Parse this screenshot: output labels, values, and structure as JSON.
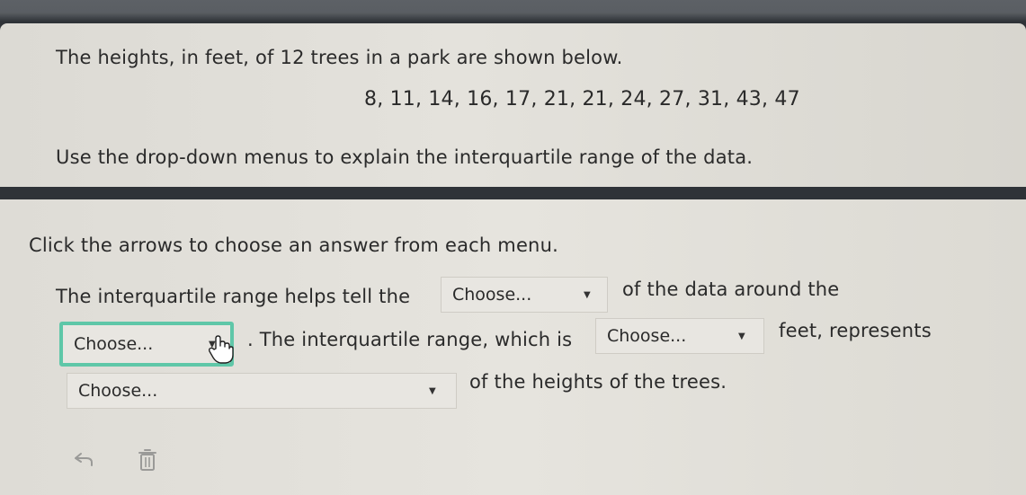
{
  "question": {
    "prompt": "The heights, in feet, of 12 trees in a park are shown below.",
    "data_values": "8, 11, 14, 16, 17, 21, 21, 24, 27, 31, 43, 47",
    "instruction": "Use the drop-down menus to explain the interquartile range of the data."
  },
  "answer_area": {
    "hint": "Click the arrows to choose an answer from each menu.",
    "sentence_part_1": "The interquartile range helps tell the",
    "sentence_part_2": "of the data around the",
    "sentence_part_3": ". The interquartile range, which is",
    "sentence_part_4": "feet, represents",
    "sentence_part_5": "of the heights of the trees."
  },
  "dropdowns": {
    "d1": {
      "selected": "Choose..."
    },
    "d2": {
      "selected": "Choose..."
    },
    "d3": {
      "selected": "Choose..."
    },
    "d4": {
      "selected": "Choose..."
    }
  },
  "icons": {
    "dropdown_arrow": "caret-down-icon",
    "cursor": "hand-pointer-icon",
    "undo": "undo-icon",
    "trash": "trash-icon"
  },
  "colors": {
    "focus_outline": "#5fc7a8",
    "panel_background": "#e2e0da",
    "header_background": "#2f3338"
  }
}
